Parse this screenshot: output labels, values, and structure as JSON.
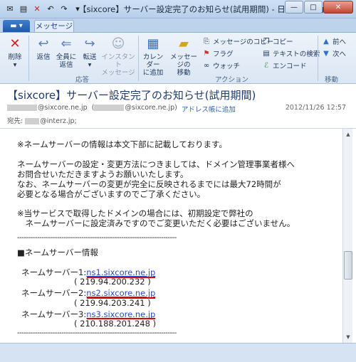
{
  "window": {
    "title": "【sixcore】サーバー設定完了のお知らせ(試用期間) - 日本語 (自動選択)"
  },
  "ribbon": {
    "file_label": "▾",
    "tab_message": "メッセージ",
    "delete": "削除",
    "reply": "返信",
    "reply_all_1": "全員に",
    "reply_all_2": "返信",
    "forward": "転送",
    "instant_1": "インスタント",
    "instant_2": "メッセージ",
    "group_respond": "応答",
    "calendar_1": "カレンダー",
    "calendar_2": "に追加",
    "move_1": "メッセージの",
    "move_2": "移動",
    "copy_message": "メッセージのコピー",
    "flag": "フラグ",
    "watch": "ウォッチ",
    "copy": "コピー",
    "find_text": "テキストの検索",
    "encoding": "エンコード",
    "group_action": "アクション",
    "prev": "前へ",
    "next": "次へ",
    "group_move": "移動"
  },
  "message": {
    "subject": "【sixcore】サーバー設定完了のお知らせ(試用期間)",
    "from_addr": "@sixcore.ne.jp",
    "from_addr2_prefix": "(",
    "from_addr2": "@sixcore.ne.jp)",
    "add_to_book": "アドレス帳に追加",
    "date": "2012/11/26 12:57",
    "to_label": "宛先:",
    "to_addr": "@interz.jp;"
  },
  "body": {
    "l1": "※ネームサーバーの情報は本文下部に記載しております。",
    "l2": "ネームサーバーの設定・変更方法につきましては、ドメイン管理事業者様へ",
    "l3": "お問合せいただきますようお願いいたします。",
    "l4": "なお、ネームサーバーの変更が完全に反映されるまでには最大72時間が",
    "l5": "必要となる場合がございますのでご了承ください。",
    "l6": "※当サービスで取得したドメインの場合には、初期設定で弊社の",
    "l7": "　ネームサーバーに設定済みですのでご変更いただく必要はございません。",
    "divider": "------------------------------------------------------------------------",
    "section": "■ネームサーバー情報",
    "ns1_label": "ネームサーバー1:",
    "ns1": "ns1.sixcore.ne.jp",
    "ns1_ip": "( 219.94.200.232 )",
    "ns2_label": "ネームサーバー2:",
    "ns2": "ns2.sixcore.ne.jp",
    "ns2_ip": "( 219.94.203.241 )",
    "ns3_label": "ネームサーバー3:",
    "ns3": "ns3.sixcore.ne.jp",
    "ns3_ip": "( 210.188.201.248 )",
    "divider2": "------------------------------------------------------------------------"
  },
  "colors": {
    "link": "#2b4cc2",
    "underline_mark": "#e00000",
    "subject": "#1e3a6e"
  }
}
